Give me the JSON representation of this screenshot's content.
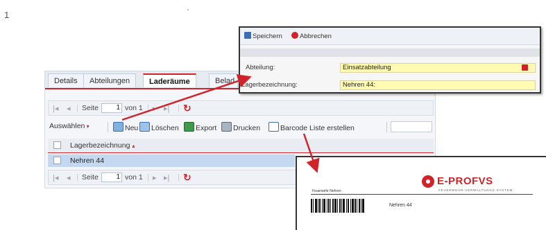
{
  "page_number": "1",
  "tabs": [
    {
      "label": "Details"
    },
    {
      "label": "Abteilungen"
    },
    {
      "label": "Laderäume"
    },
    {
      "label": "Belad"
    }
  ],
  "pager": {
    "page_label": "Seite",
    "page_value": "1",
    "of_label": "von 1"
  },
  "toolbar": {
    "select_label": "Auswählen",
    "new_label": "Neu",
    "delete_label": "Löschen",
    "export_label": "Export",
    "print_label": "Drucken",
    "barcode_label": "Barcode Liste erstellen"
  },
  "grid": {
    "column_header": "Lagerbezeichnung",
    "rows": [
      {
        "name": "Nehren 44"
      }
    ]
  },
  "edit_popup": {
    "save_label": "Speichern",
    "cancel_label": "Abbrechen",
    "department_label": "Abteilung:",
    "department_value": "Einsatzabteilung",
    "storage_label": "Lagerbezeichnung:",
    "storage_value": "Nehren 44:"
  },
  "barcode_label": {
    "logo_text": "E-PROFVS",
    "logo_subtitle": "FEUERWEHR-VERWALTUNGS-SYSTEM",
    "department": "Feuerwehr Nehren",
    "text": "Nehren 44"
  },
  "colors": {
    "accent_red": "#d0232a",
    "field_yellow": "#fffbb2",
    "selection_blue": "#c4d8f2"
  },
  "icons": [
    "refresh-icon",
    "new-icon",
    "delete-icon",
    "export-icon",
    "print-icon",
    "barcode-icon",
    "save-icon",
    "cancel-icon",
    "dropdown-arrow-icon"
  ]
}
